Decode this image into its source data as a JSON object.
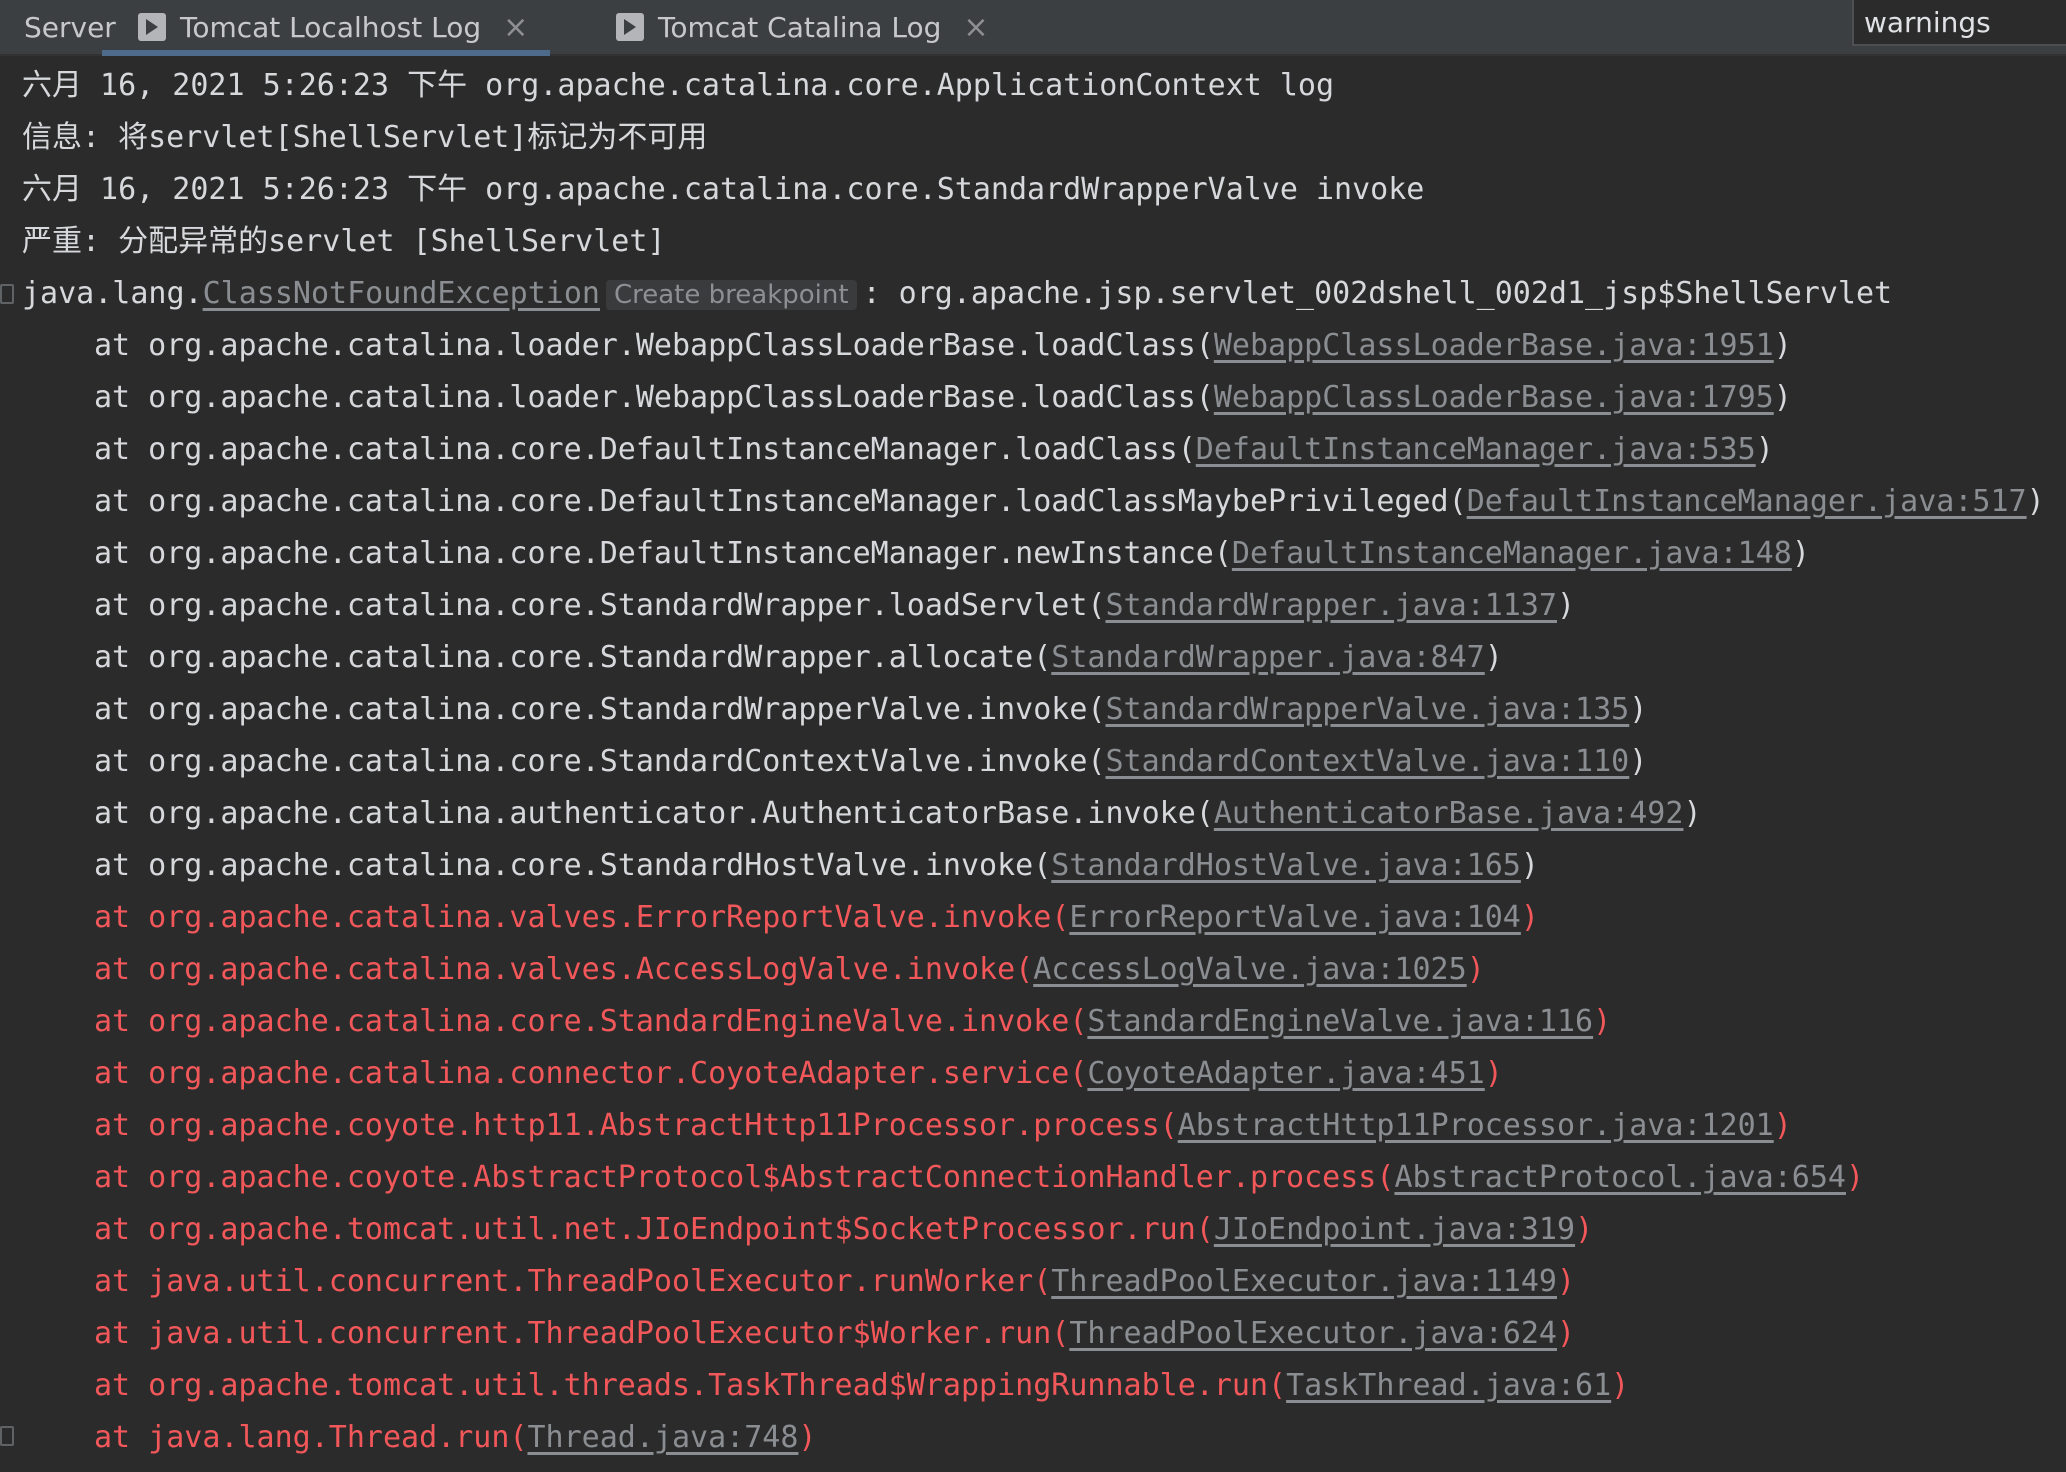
{
  "tabs": [
    {
      "label": "Server"
    },
    {
      "label": "Tomcat Localhost Log",
      "close": "×"
    },
    {
      "label": "Tomcat Catalina Log",
      "close": "×"
    }
  ],
  "search": {
    "value": "warnings"
  },
  "log": {
    "line1": "六月 16, 2021 5:26:23 下午 org.apache.catalina.core.ApplicationContext log",
    "line2": "信息: 将servlet[ShellServlet]标记为不可用",
    "line3": "六月 16, 2021 5:26:23 下午 org.apache.catalina.core.StandardWrapperValve invoke",
    "line4": "严重: 分配异常的servlet [ShellServlet]",
    "exception": {
      "prefix": "java.lang.",
      "link": "ClassNotFoundException",
      "hint": "Create breakpoint",
      "suffix": ": org.apache.jsp.servlet_002dshell_002d1_jsp$ShellServlet"
    },
    "frames": [
      {
        "text": "at org.apache.catalina.loader.WebappClassLoaderBase.loadClass(",
        "link": "WebappClassLoaderBase.java:1951"
      },
      {
        "text": "at org.apache.catalina.loader.WebappClassLoaderBase.loadClass(",
        "link": "WebappClassLoaderBase.java:1795"
      },
      {
        "text": "at org.apache.catalina.core.DefaultInstanceManager.loadClass(",
        "link": "DefaultInstanceManager.java:535"
      },
      {
        "text": "at org.apache.catalina.core.DefaultInstanceManager.loadClassMaybePrivileged(",
        "link": "DefaultInstanceManager.java:517"
      },
      {
        "text": "at org.apache.catalina.core.DefaultInstanceManager.newInstance(",
        "link": "DefaultInstanceManager.java:148"
      },
      {
        "text": "at org.apache.catalina.core.StandardWrapper.loadServlet(",
        "link": "StandardWrapper.java:1137"
      },
      {
        "text": "at org.apache.catalina.core.StandardWrapper.allocate(",
        "link": "StandardWrapper.java:847"
      },
      {
        "text": "at org.apache.catalina.core.StandardWrapperValve.invoke(",
        "link": "StandardWrapperValve.java:135"
      },
      {
        "text": "at org.apache.catalina.core.StandardContextValve.invoke(",
        "link": "StandardContextValve.java:110"
      },
      {
        "text": "at org.apache.catalina.authenticator.AuthenticatorBase.invoke(",
        "link": "AuthenticatorBase.java:492"
      },
      {
        "text": "at org.apache.catalina.core.StandardHostValve.invoke(",
        "link": "StandardHostValve.java:165"
      },
      {
        "text": "at org.apache.catalina.valves.ErrorReportValve.invoke(",
        "link": "ErrorReportValve.java:104"
      },
      {
        "text": "at org.apache.catalina.valves.AccessLogValve.invoke(",
        "link": "AccessLogValve.java:1025"
      },
      {
        "text": "at org.apache.catalina.core.StandardEngineValve.invoke(",
        "link": "StandardEngineValve.java:116"
      },
      {
        "text": "at org.apache.catalina.connector.CoyoteAdapter.service(",
        "link": "CoyoteAdapter.java:451"
      },
      {
        "text": "at org.apache.coyote.http11.AbstractHttp11Processor.process(",
        "link": "AbstractHttp11Processor.java:1201"
      },
      {
        "text": "at org.apache.coyote.AbstractProtocol$AbstractConnectionHandler.process(",
        "link": "AbstractProtocol.java:654"
      },
      {
        "text": "at org.apache.tomcat.util.net.JIoEndpoint$SocketProcessor.run(",
        "link": "JIoEndpoint.java:319"
      },
      {
        "text": "at java.util.concurrent.ThreadPoolExecutor.runWorker(",
        "link": "ThreadPoolExecutor.java:1149"
      },
      {
        "text": "at java.util.concurrent.ThreadPoolExecutor$Worker.run(",
        "link": "ThreadPoolExecutor.java:624"
      },
      {
        "text": "at org.apache.tomcat.util.threads.TaskThread$WrappingRunnable.run(",
        "link": "TaskThread.java:61"
      },
      {
        "text": "at java.lang.Thread.run(",
        "link": "Thread.java:748"
      }
    ],
    "close_paren": ")"
  },
  "colors": {
    "background": "#2b2b2b",
    "error_text": "#f2575a",
    "link": "#8a8d91"
  }
}
